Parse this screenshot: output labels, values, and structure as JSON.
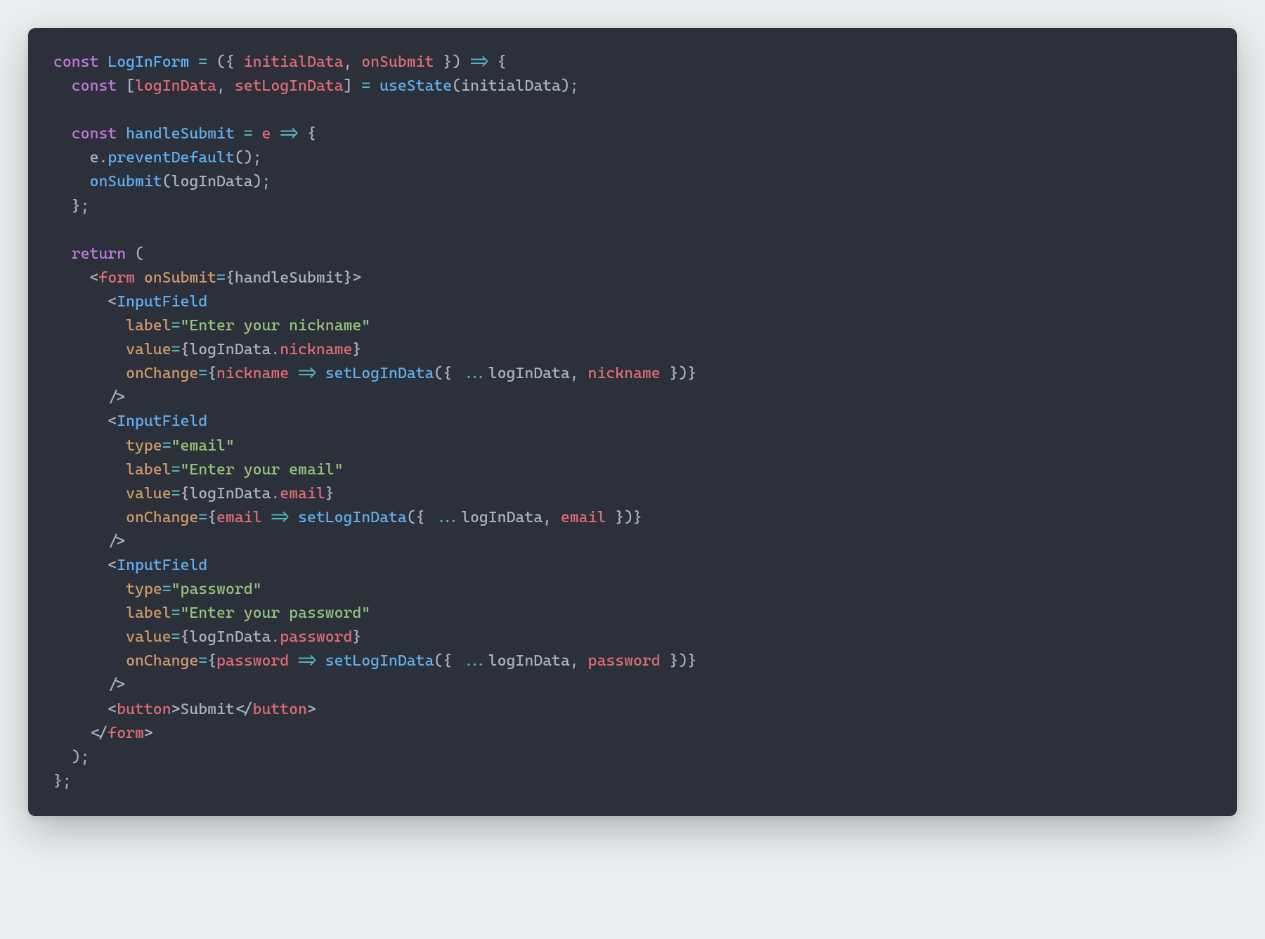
{
  "code": {
    "componentName": "LogInForm",
    "params": [
      "initialData",
      "onSubmit"
    ],
    "stateVar": "logInData",
    "stateSetter": "setLogInData",
    "hook": "useState",
    "stateInit": "initialData",
    "handlerName": "handleSubmit",
    "handlerParam": "e",
    "preventDefault": "preventDefault",
    "submitCall": "onSubmit",
    "submitArg": "logInData",
    "formTag": "form",
    "onSubmitAttr": "onSubmit",
    "inputFieldTag": "InputField",
    "labelAttr": "label",
    "typeAttr": "type",
    "valueAttr": "value",
    "onChangeAttr": "onChange",
    "fields": [
      {
        "type": null,
        "label": "Enter your nickname",
        "prop": "nickname"
      },
      {
        "type": "email",
        "label": "Enter your email",
        "prop": "email"
      },
      {
        "type": "password",
        "label": "Enter your password",
        "prop": "password"
      }
    ],
    "buttonTag": "button",
    "buttonText": "Submit"
  }
}
